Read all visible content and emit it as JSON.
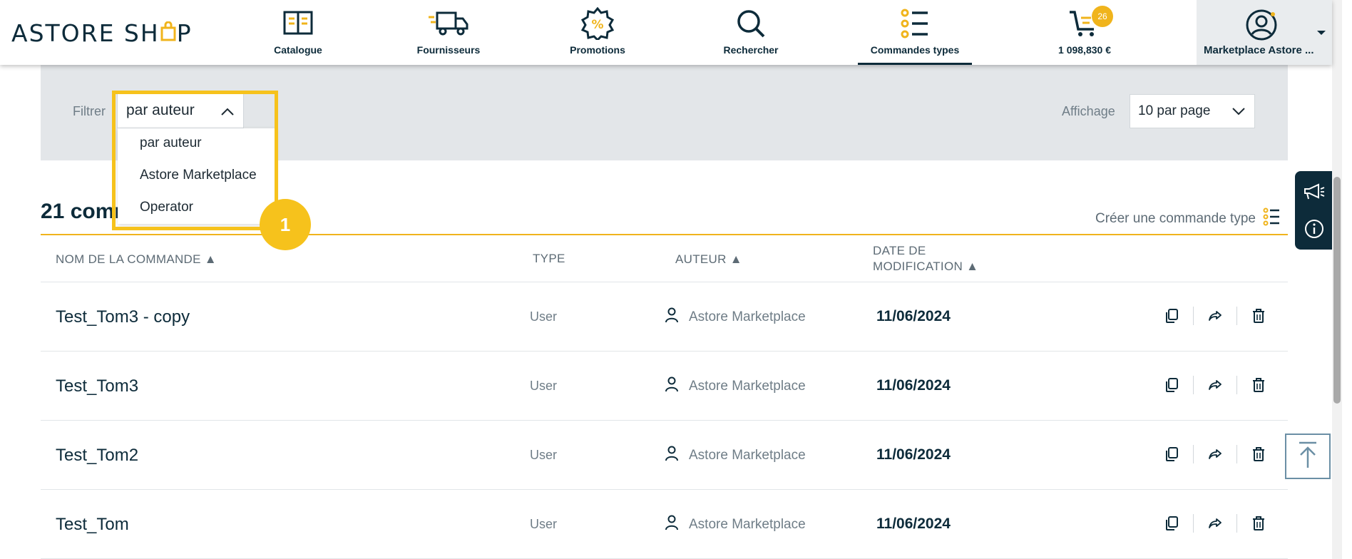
{
  "brand": {
    "logo_prefix": "ASTORE SH",
    "logo_o": "O",
    "logo_suffix": "P",
    "accent_color": "#f0b41c",
    "primary_color": "#0d2b3a"
  },
  "nav": {
    "items": [
      {
        "label": "Catalogue",
        "icon": "book-icon"
      },
      {
        "label": "Fournisseurs",
        "icon": "truck-icon"
      },
      {
        "label": "Promotions",
        "icon": "promo-badge-icon"
      },
      {
        "label": "Rechercher",
        "icon": "search-icon"
      },
      {
        "label": "Commandes types",
        "icon": "list-icon"
      },
      {
        "label": "1 098,830 €",
        "icon": "cart-icon"
      }
    ],
    "cart_count": "26",
    "account_label": "Marketplace Astore ..."
  },
  "filter": {
    "label": "Filtrer",
    "selected": "par auteur",
    "options": [
      "par auteur",
      "Astore Marketplace",
      "Operator"
    ],
    "step_badge": "1"
  },
  "display": {
    "label": "Affichage",
    "selected": "10 par page"
  },
  "list": {
    "title": "21 comm",
    "create_label": "Créer une commande type"
  },
  "table": {
    "headers": {
      "name": "NOM DE LA COMMANDE ▲",
      "type": "TYPE",
      "author": "AUTEUR ▲",
      "date_line1": "DATE DE",
      "date_line2": "MODIFICATION ▲"
    },
    "rows": [
      {
        "name": "Test_Tom3 - copy",
        "type": "User",
        "author": "Astore Marketplace",
        "date": "11/06/2024"
      },
      {
        "name": "Test_Tom3",
        "type": "User",
        "author": "Astore Marketplace",
        "date": "11/06/2024"
      },
      {
        "name": "Test_Tom2",
        "type": "User",
        "author": "Astore Marketplace",
        "date": "11/06/2024"
      },
      {
        "name": "Test_Tom",
        "type": "User",
        "author": "Astore Marketplace",
        "date": "11/06/2024"
      }
    ]
  }
}
